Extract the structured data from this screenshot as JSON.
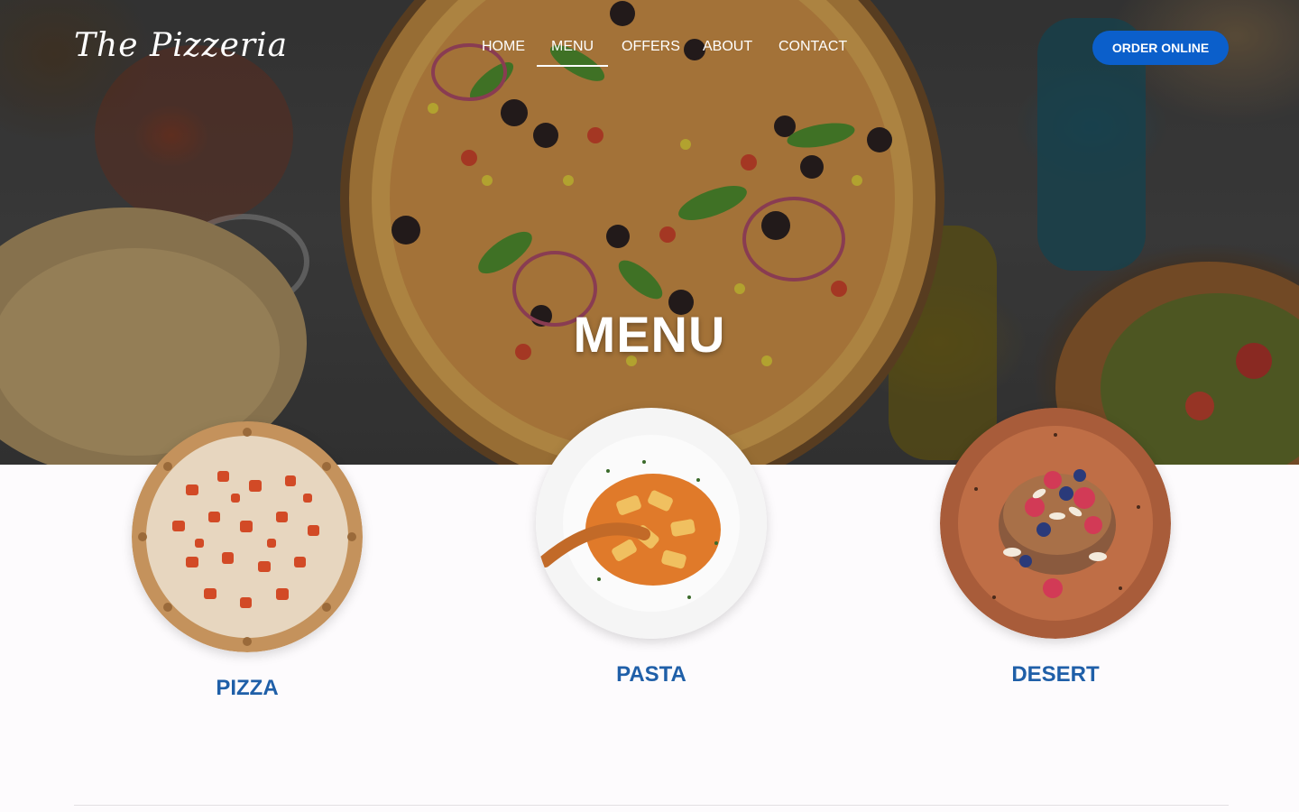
{
  "brand": {
    "logo_text": "The Pizzeria"
  },
  "nav": {
    "items": [
      {
        "label": "HOME",
        "active": false
      },
      {
        "label": "MENU",
        "active": true
      },
      {
        "label": "OFFERS",
        "active": false
      },
      {
        "label": "ABOUT",
        "active": false
      },
      {
        "label": "CONTACT",
        "active": false
      }
    ],
    "cta_label": "ORDER ONLINE"
  },
  "hero": {
    "title": "MENU"
  },
  "menu": {
    "categories": [
      {
        "label": "PIZZA",
        "image": "pizza-image"
      },
      {
        "label": "PASTA",
        "image": "pasta-image"
      },
      {
        "label": "DESERT",
        "image": "dessert-image"
      }
    ]
  },
  "colors": {
    "accent": "#0b5fcb",
    "category_label": "#1f5fa8",
    "background": "#fdfbfd"
  }
}
